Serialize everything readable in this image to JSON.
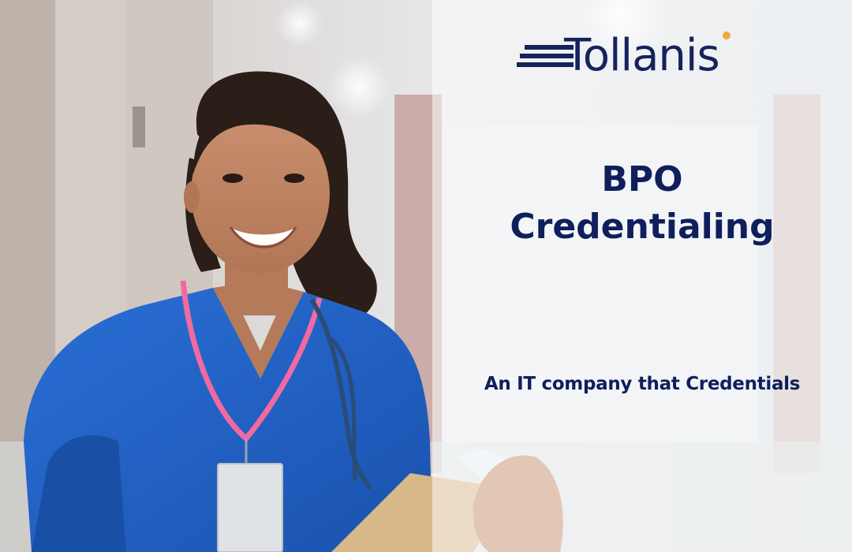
{
  "brand": {
    "name": "Tollanis",
    "text_color": "#14235c",
    "accent_dot_color": "#f2a93b"
  },
  "headline": {
    "line1": "BPO",
    "line2": "Credentialing"
  },
  "tagline": "An IT company that Credentials",
  "colors": {
    "text_navy": "#0f1f5c",
    "scrubs_blue": "#1e5fc4",
    "lanyard_pink": "#f06aa0",
    "hallway_bg": "#dfe3e7"
  },
  "photo": {
    "subject": "smiling nurse in blue scrubs with stethoscope, pink lanyard, ID badge and clipboard in hospital hallway"
  }
}
